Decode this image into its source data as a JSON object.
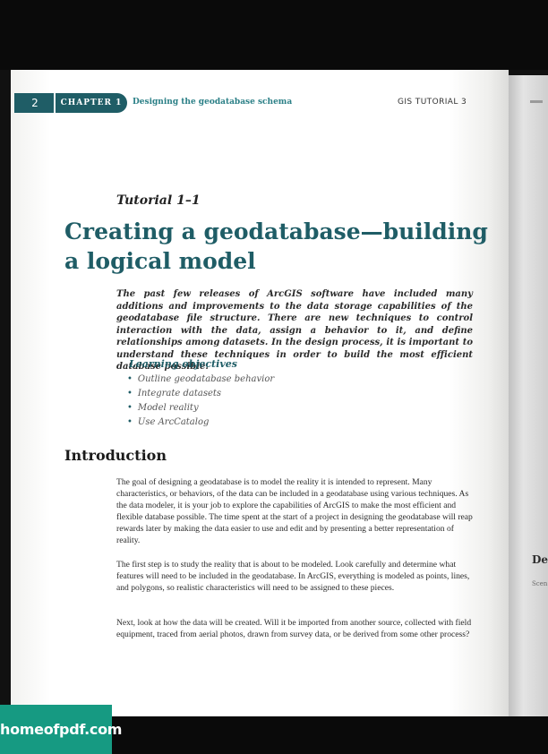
{
  "header": {
    "page_number": "2",
    "chapter_label": "CHAPTER 1",
    "chapter_title": "Designing the geodatabase schema",
    "running_head": "GIS TUTORIAL 3"
  },
  "tutorial_label": "Tutorial 1–1",
  "title": "Creating a geodatabase—building a logical model",
  "intro": "The past few releases of ArcGIS software have included many additions and improvements to the data storage capabilities of the geodatabase file structure. There are new techniques to control interaction with the data, assign a behavior to it, and define relationships among datasets. In the design process, it is important to understand these techniques in order to build the most efficient database possible.",
  "learning_objectives": {
    "title": "Learning objectives",
    "items": [
      "Outline geodatabase behavior",
      "Integrate datasets",
      "Model reality",
      "Use ArcCatalog"
    ]
  },
  "section_heading": "Introduction",
  "paragraphs": [
    "The goal of designing a geodatabase is to model the reality it is intended to represent. Many characteristics, or behaviors, of the data can be included in a geodatabase using various techniques. As the data modeler, it is your job to explore the capabilities of ArcGIS to make the most efficient and flexible database possible. The time spent at the start of a project in designing the geodatabase will reap rewards later by making the data easier to use and edit and by presenting a better representation of reality.",
    "The first step is to study the reality that is about to be modeled. Look carefully and determine what features will need to be included in the geodatabase. In ArcGIS, everything is modeled as points, lines, and polygons, so realistic characteristics will need to be assigned to these pieces.",
    "Next, look at how the data will be created. Will it be imported from another source, collected with field equipment, traced from aerial photos, drawn from survey data, or be derived from some other process?"
  ],
  "next_page_edge": {
    "heading": "Des",
    "subtext": "Scen"
  },
  "watermark": "homeofpdf.com",
  "colors": {
    "accent": "#1f5d66",
    "chapter_title": "#2a7f86",
    "watermark_bg": "#169a82"
  }
}
